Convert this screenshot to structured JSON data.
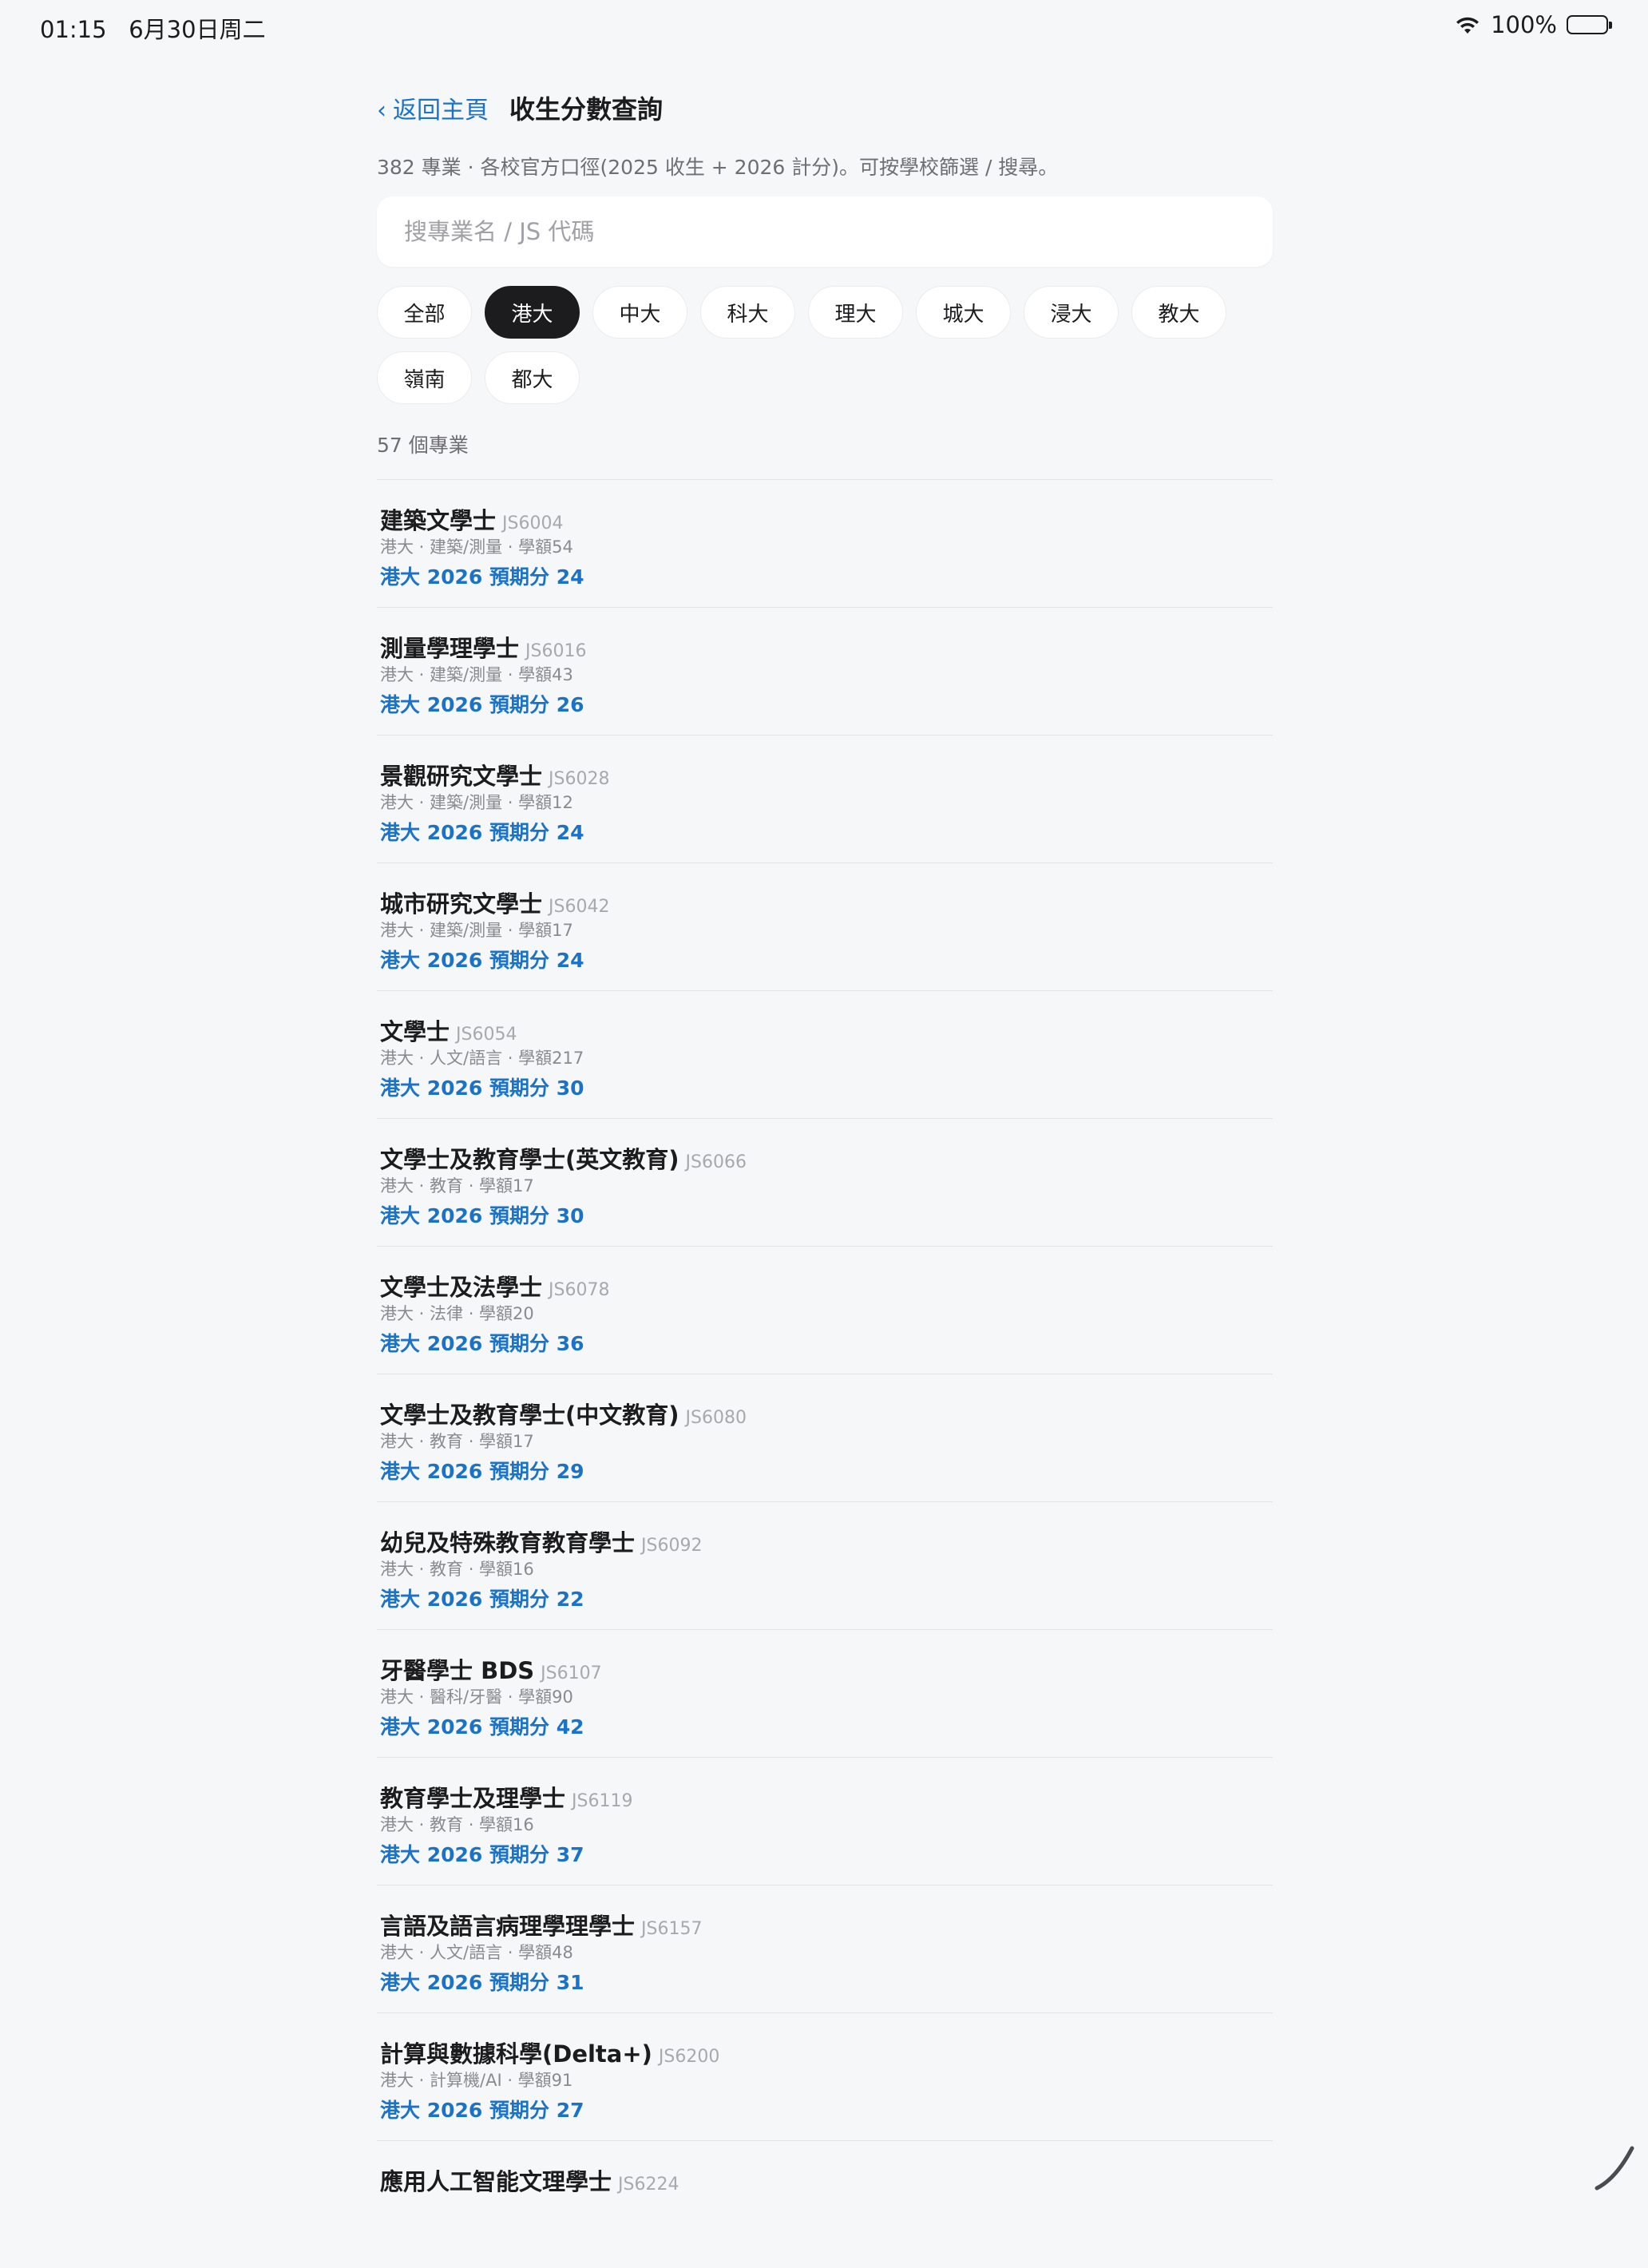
{
  "status_bar": {
    "time": "01:15",
    "date": "6月30日周二",
    "battery": "100%",
    "icons": [
      "wifi-icon",
      "battery-icon"
    ]
  },
  "header": {
    "back_label": "返回主頁",
    "back_icon": "chevron-left-icon",
    "title": "收生分數查詢"
  },
  "subtitle": "382 專業 · 各校官方口徑(2025 收生 + 2026 計分)。可按學校篩選 / 搜尋。",
  "search": {
    "placeholder": "搜專業名 / JS 代碼",
    "value": ""
  },
  "filters": [
    {
      "label": "全部",
      "selected": false
    },
    {
      "label": "港大",
      "selected": true
    },
    {
      "label": "中大",
      "selected": false
    },
    {
      "label": "科大",
      "selected": false
    },
    {
      "label": "理大",
      "selected": false
    },
    {
      "label": "城大",
      "selected": false
    },
    {
      "label": "浸大",
      "selected": false
    },
    {
      "label": "教大",
      "selected": false
    },
    {
      "label": "嶺南",
      "selected": false
    },
    {
      "label": "都大",
      "selected": false
    }
  ],
  "result_count": "57 個專業",
  "programmes": [
    {
      "name": "建築文學士",
      "code": "JS6004",
      "meta": "港大 · 建築/測量 · 學額54",
      "score": "港大 2026 預期分 24"
    },
    {
      "name": "測量學理學士",
      "code": "JS6016",
      "meta": "港大 · 建築/測量 · 學額43",
      "score": "港大 2026 預期分 26"
    },
    {
      "name": "景觀研究文學士",
      "code": "JS6028",
      "meta": "港大 · 建築/測量 · 學額12",
      "score": "港大 2026 預期分 24"
    },
    {
      "name": "城市研究文學士",
      "code": "JS6042",
      "meta": "港大 · 建築/測量 · 學額17",
      "score": "港大 2026 預期分 24"
    },
    {
      "name": "文學士",
      "code": "JS6054",
      "meta": "港大 · 人文/語言 · 學額217",
      "score": "港大 2026 預期分 30"
    },
    {
      "name": "文學士及教育學士(英文教育)",
      "code": "JS6066",
      "meta": "港大 · 教育 · 學額17",
      "score": "港大 2026 預期分 30"
    },
    {
      "name": "文學士及法學士",
      "code": "JS6078",
      "meta": "港大 · 法律 · 學額20",
      "score": "港大 2026 預期分 36"
    },
    {
      "name": "文學士及教育學士(中文教育)",
      "code": "JS6080",
      "meta": "港大 · 教育 · 學額17",
      "score": "港大 2026 預期分 29"
    },
    {
      "name": "幼兒及特殊教育教育學士",
      "code": "JS6092",
      "meta": "港大 · 教育 · 學額16",
      "score": "港大 2026 預期分 22"
    },
    {
      "name": "牙醫學士 BDS",
      "code": "JS6107",
      "meta": "港大 · 醫科/牙醫 · 學額90",
      "score": "港大 2026 預期分 42"
    },
    {
      "name": "教育學士及理學士",
      "code": "JS6119",
      "meta": "港大 · 教育 · 學額16",
      "score": "港大 2026 預期分 37"
    },
    {
      "name": "言語及語言病理學理學士",
      "code": "JS6157",
      "meta": "港大 · 人文/語言 · 學額48",
      "score": "港大 2026 預期分 31"
    },
    {
      "name": "計算與數據科學(Delta+)",
      "code": "JS6200",
      "meta": "港大 · 計算機/AI · 學額91",
      "score": "港大 2026 預期分 27"
    },
    {
      "name": "應用人工智能文理學士",
      "code": "JS6224",
      "meta": "",
      "score": ""
    }
  ],
  "colors": {
    "accent": "#1a73c9",
    "background": "#f6f7f9",
    "chip_active": "#1c1c1e"
  }
}
